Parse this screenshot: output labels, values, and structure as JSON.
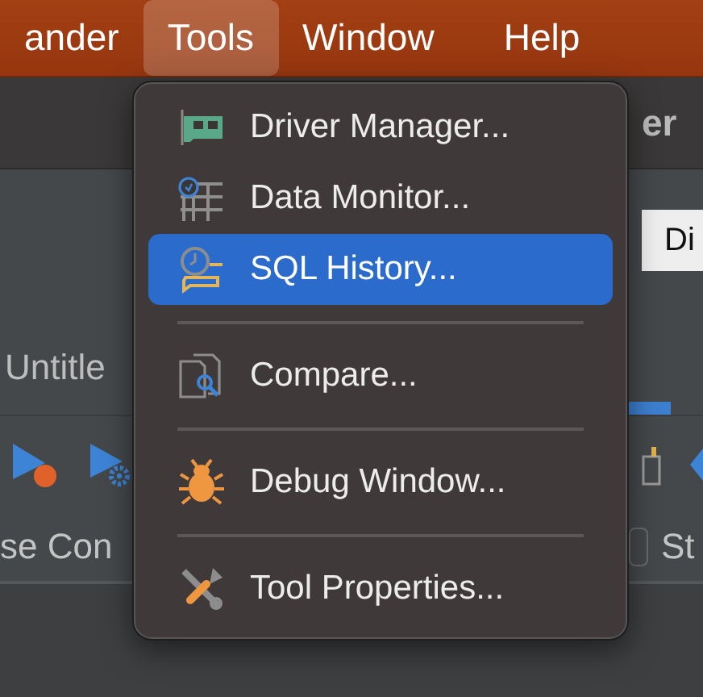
{
  "menubar": {
    "items": [
      {
        "label": "ander",
        "selected": false
      },
      {
        "label": "Tools",
        "selected": true
      },
      {
        "label": "Window",
        "selected": false
      },
      {
        "label": "Help",
        "selected": false
      }
    ]
  },
  "backdrop": {
    "title_fragment": "er",
    "button_label": "Di",
    "tab_label": "Untitle",
    "connection_label": "se Con",
    "option": {
      "label": "St",
      "checked": false
    }
  },
  "menu": {
    "items": [
      {
        "kind": "item",
        "label": "Driver Manager...",
        "selected": false
      },
      {
        "kind": "item",
        "label": "Data Monitor...",
        "selected": false
      },
      {
        "kind": "item",
        "label": "SQL History...",
        "selected": true
      },
      {
        "kind": "separator"
      },
      {
        "kind": "item",
        "label": "Compare...",
        "selected": false
      },
      {
        "kind": "separator"
      },
      {
        "kind": "item",
        "label": "Debug Window...",
        "selected": false
      },
      {
        "kind": "separator"
      },
      {
        "kind": "item",
        "label": "Tool Properties...",
        "selected": false
      }
    ]
  }
}
